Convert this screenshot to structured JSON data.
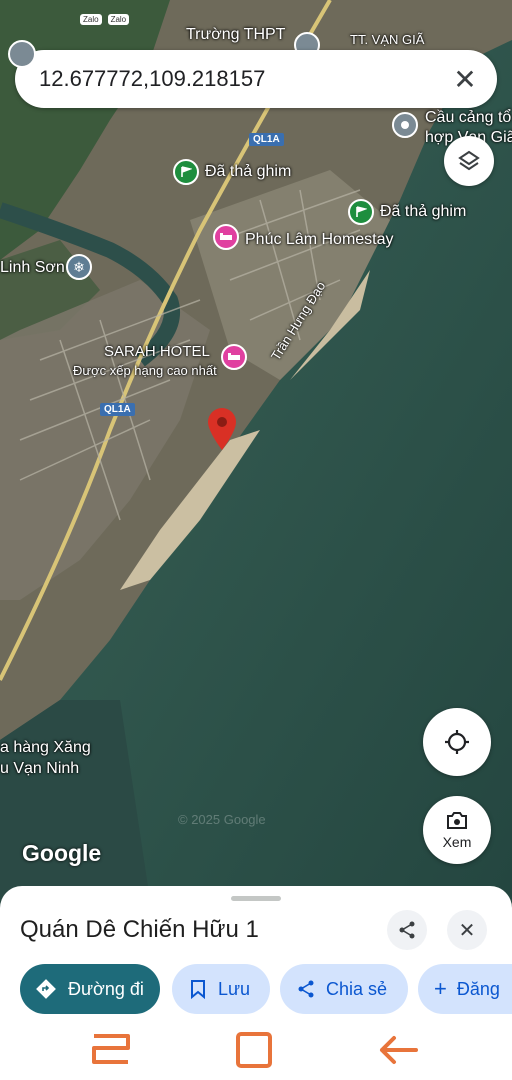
{
  "status_bar": {
    "app_icons": [
      "Zalo",
      "Zalo"
    ]
  },
  "search": {
    "value": "12.677772,109.218157",
    "clear_label": "✕"
  },
  "map": {
    "labels": {
      "school": "Trường THPT",
      "town": "TT. Vạn Giã",
      "port_line1": "Cầu cảng tổ",
      "port_line2": "hợp Vạn Giã",
      "pin1": "Đã thả ghim",
      "pin2": "Đã thả ghim",
      "homestay": "Phúc Lâm Homestay",
      "linh_son": "Linh Sơn",
      "hotel_name": "SARAH HOTEL",
      "hotel_sub": "Được xếp hạng cao nhất",
      "road_ql1a_top": "QL1A",
      "road_ql1a_mid": "QL1A",
      "street": "Trần Hưng Đạo",
      "gas_line1": "a hàng Xăng",
      "gas_line2": "u Vạn Ninh",
      "watermark": "© 2025 Google",
      "google": "Google"
    },
    "locate_icon": "crosshair-icon",
    "layers_icon": "layers-icon",
    "view_label": "Xem"
  },
  "sheet": {
    "title": "Quán Dê Chiến Hữu 1",
    "actions": {
      "directions": "Đường đi",
      "save": "Lưu",
      "share": "Chia sẻ",
      "post": "Đăng"
    }
  },
  "colors": {
    "sea": "#2f5a52",
    "land": "#6b6b5e",
    "accent": "#1e6b7a",
    "chip_bg": "#d3e3fd",
    "pin_red": "#d93025",
    "nav_icon": "#e8743b"
  }
}
